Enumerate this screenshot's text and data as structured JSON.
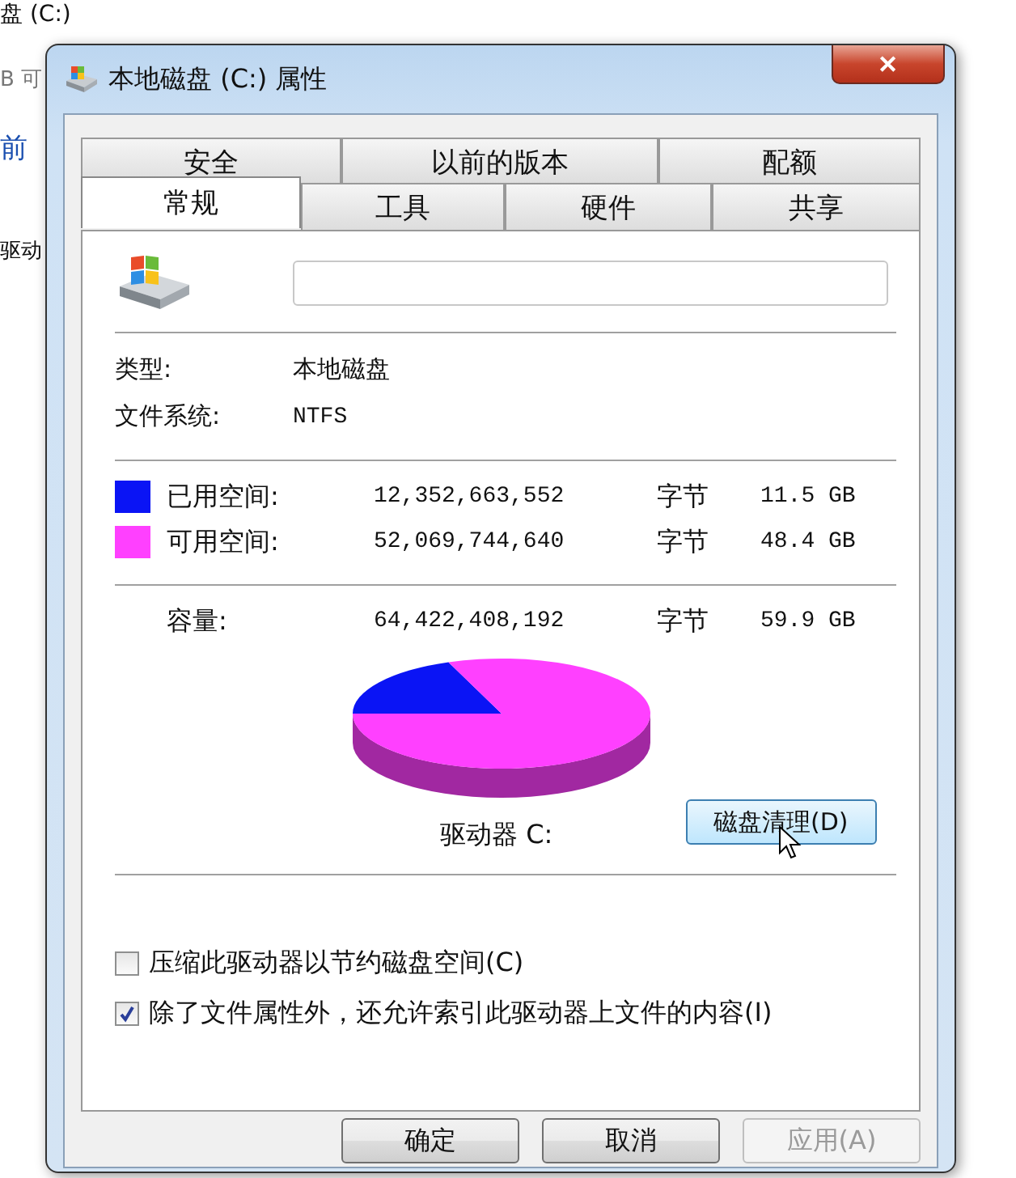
{
  "background_window": {
    "texts": [
      "盘 (C:)",
      "B 可",
      "前",
      "驱动"
    ]
  },
  "window": {
    "title": "本地磁盘 (C:) 属性",
    "close": "✕"
  },
  "tabs": [
    [
      {
        "label": "安全",
        "selected": false
      },
      {
        "label": "以前的版本",
        "selected": false
      },
      {
        "label": "配额",
        "selected": false
      }
    ],
    [
      {
        "label": "常规",
        "selected": true
      },
      {
        "label": "工具",
        "selected": false
      },
      {
        "label": "硬件",
        "selected": false
      },
      {
        "label": "共享",
        "selected": false
      }
    ]
  ],
  "general": {
    "info": [
      {
        "label": "类型:",
        "value": "本地磁盘"
      },
      {
        "label": "文件系统:",
        "value": "NTFS"
      }
    ],
    "space": [
      {
        "label": "已用空间:",
        "bytes": "12,352,663,552",
        "unit": "字节",
        "size": "11.5 GB",
        "color": "#0a14f5"
      },
      {
        "label": "可用空间:",
        "bytes": "52,069,744,640",
        "unit": "字节",
        "size": "48.4 GB",
        "color": "#ff40ff"
      }
    ],
    "capacity": {
      "label": "容量:",
      "bytes": "64,422,408,192",
      "unit": "字节",
      "size": "59.9 GB"
    },
    "drive_label": "驱动器 C:",
    "cleanup_button": "磁盘清理(D)",
    "options": [
      {
        "label": "压缩此驱动器以节约磁盘空间(C)",
        "checked": false
      },
      {
        "label": "除了文件属性外，还允许索引此驱动器上文件的内容(I)",
        "checked": true
      }
    ]
  },
  "buttons": [
    {
      "label": "确定",
      "disabled": false
    },
    {
      "label": "取消",
      "disabled": false
    },
    {
      "label": "应用(A)",
      "disabled": true
    }
  ]
}
